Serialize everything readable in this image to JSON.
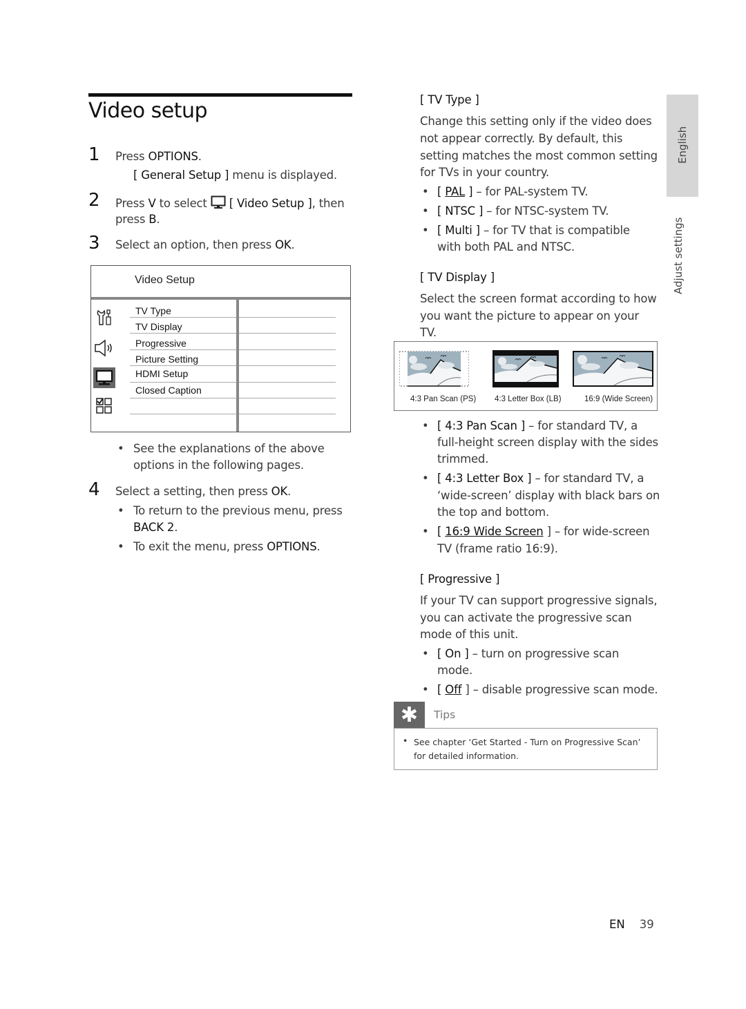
{
  "page": {
    "title": "Video setup",
    "side_tabs": {
      "language": "English",
      "section": "Adjust settings"
    },
    "footer": {
      "lang": "EN",
      "page_number": "39"
    }
  },
  "steps": [
    {
      "num": "1",
      "line1_a": "Press ",
      "line1_b": "OPTIONS",
      "line1_c": ".",
      "sub_a": "[ General Setup ]",
      "sub_b": " menu is displayed."
    },
    {
      "num": "2",
      "a": "Press ",
      "b": "V",
      "c": " to select ",
      "icon": "tv-monitor-icon",
      "d": " [ Video Setup ]",
      "e": ", then",
      "line2_a": "press ",
      "line2_b": "B",
      "line2_c": "."
    },
    {
      "num": "3",
      "a": "Select an option, then press ",
      "b": "OK",
      "c": "."
    },
    {
      "num": "4",
      "a": "Select a setting, then press ",
      "b": "OK",
      "c": "."
    }
  ],
  "step3_bullet": {
    "line1": "See the explanations of the above",
    "line2": "options in the following pages."
  },
  "step4_bullets": [
    {
      "line1": "To return to the previous menu, press",
      "line2_b": "BACK  2",
      "line2_c": "."
    },
    {
      "a": "To exit the menu, press ",
      "b": "OPTIONS",
      "c": "."
    }
  ],
  "menu": {
    "title": "Video Setup",
    "items": [
      "TV Type",
      "TV Display",
      "Progressive",
      "Picture Setting",
      "HDMI Setup",
      "Closed Caption"
    ],
    "icons": [
      "tools-icon",
      "speaker-icon",
      "tv-monitor-icon",
      "preferences-grid-icon"
    ],
    "selected_icon": "tv-monitor-icon"
  },
  "tv_type": {
    "heading": "[ TV Type ]",
    "desc": [
      "Change this setting only if the video does",
      "not appear correctly.  By default, this",
      "setting matches the most common setting",
      "for TVs in your country."
    ],
    "options": [
      {
        "open": "[ ",
        "name": "PAL",
        "close": " ]",
        "desc": " – for PAL-system TV.",
        "default": true
      },
      {
        "open": "[ ",
        "name": "NTSC",
        "close": " ]",
        "desc": " – for NTSC-system TV.",
        "default": false
      },
      {
        "open": "[ ",
        "name": "Multi",
        "close": " ]",
        "desc": " – for TV that is compatible",
        "desc2": "with both PAL and NTSC.",
        "default": false
      }
    ]
  },
  "tv_display": {
    "heading": "[ TV Display ]",
    "desc": [
      "Select the screen format according to how",
      "you want the picture to appear on your",
      "TV."
    ],
    "thumbnails": [
      "4:3 Pan Scan (PS)",
      "4:3 Letter Box (LB)",
      "16:9 (Wide Screen)"
    ],
    "options": [
      {
        "name": "[ 4:3 Pan Scan ]",
        "lines": [
          " – for standard TV, a",
          "full-height screen display with the sides",
          "trimmed."
        ]
      },
      {
        "name": "[ 4:3 Letter Box ]",
        "lines": [
          " – for standard TV,  a",
          "‘wide-screen’ display with black bars on",
          "the top and bottom."
        ]
      },
      {
        "name": "16:9 Wide Screen",
        "default": true,
        "lines": [
          " ] – for wide-screen",
          "TV (frame ratio 16:9)."
        ]
      }
    ]
  },
  "progressive": {
    "heading": "[ Progressive ]",
    "desc": [
      "If your TV can support progressive signals,",
      "you can activate the progressive scan",
      "mode of this unit."
    ],
    "options": [
      {
        "name": "[ On ]",
        "lines": [
          " – turn on progressive scan",
          "mode."
        ]
      },
      {
        "name": "Off",
        "default": true,
        "lines": [
          " ] – disable progressive scan mode."
        ]
      }
    ]
  },
  "tips": {
    "label": "Tips",
    "icon": "asterisk-tip-icon",
    "text": [
      "See chapter ‘Get Started - Turn on Progressive Scan’",
      "for detailed information."
    ]
  }
}
